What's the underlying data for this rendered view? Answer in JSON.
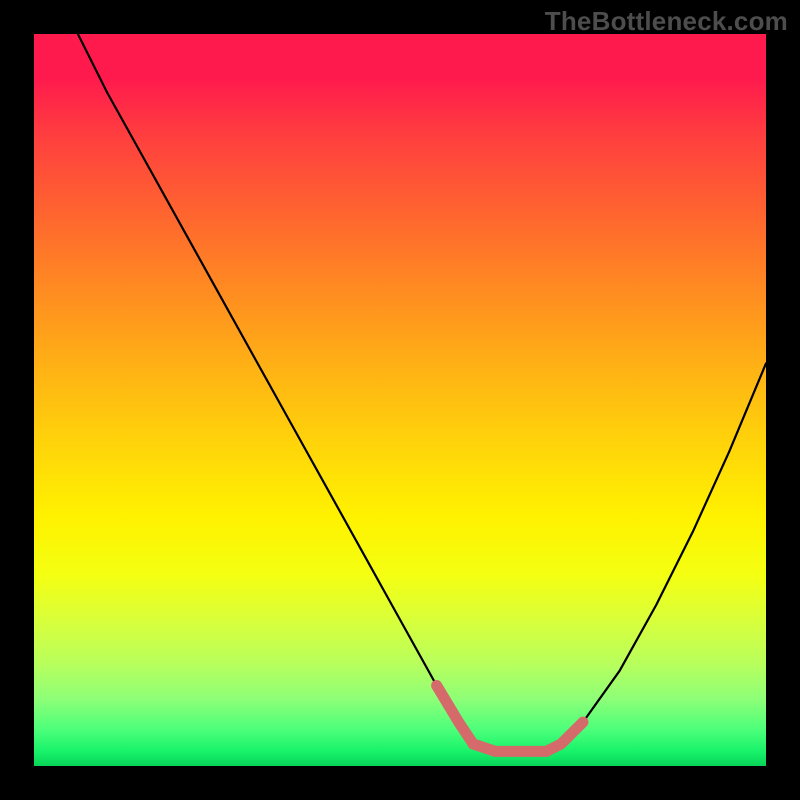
{
  "watermark": "TheBottleneck.com",
  "colors": {
    "frame": "#000000",
    "curve_stroke": "#000000",
    "highlight_stroke": "#d46a6a",
    "gradient_stops": [
      "#ff1a4d",
      "#ff3f3f",
      "#ff6a2d",
      "#ff8f20",
      "#ffb314",
      "#ffd40a",
      "#fff200",
      "#f4ff12",
      "#d9ff3a",
      "#b8ff5c",
      "#8cff78",
      "#4dff7a",
      "#18f26a",
      "#08d458"
    ]
  },
  "chart_data": {
    "type": "line",
    "title": "",
    "xlabel": "",
    "ylabel": "",
    "xlim": [
      0,
      100
    ],
    "ylim": [
      0,
      100
    ],
    "grid": false,
    "legend": false,
    "series": [
      {
        "name": "bottleneck-curve",
        "x": [
          6,
          10,
          15,
          20,
          25,
          30,
          35,
          40,
          45,
          50,
          55,
          58,
          60,
          63,
          66,
          70,
          72,
          75,
          80,
          85,
          90,
          95,
          100
        ],
        "y": [
          100,
          92,
          83,
          74,
          65,
          56,
          47,
          38,
          29,
          20,
          11,
          6,
          3,
          2,
          2,
          2,
          3,
          6,
          13,
          22,
          32,
          43,
          55
        ]
      }
    ],
    "highlights": [
      {
        "name": "left-knee",
        "x": [
          55,
          58,
          60
        ],
        "y": [
          11,
          6,
          3
        ]
      },
      {
        "name": "flat-min",
        "x": [
          60,
          63,
          66,
          70
        ],
        "y": [
          3,
          2,
          2,
          2
        ]
      },
      {
        "name": "right-knee",
        "x": [
          70,
          72,
          75
        ],
        "y": [
          2,
          3,
          6
        ]
      }
    ]
  }
}
